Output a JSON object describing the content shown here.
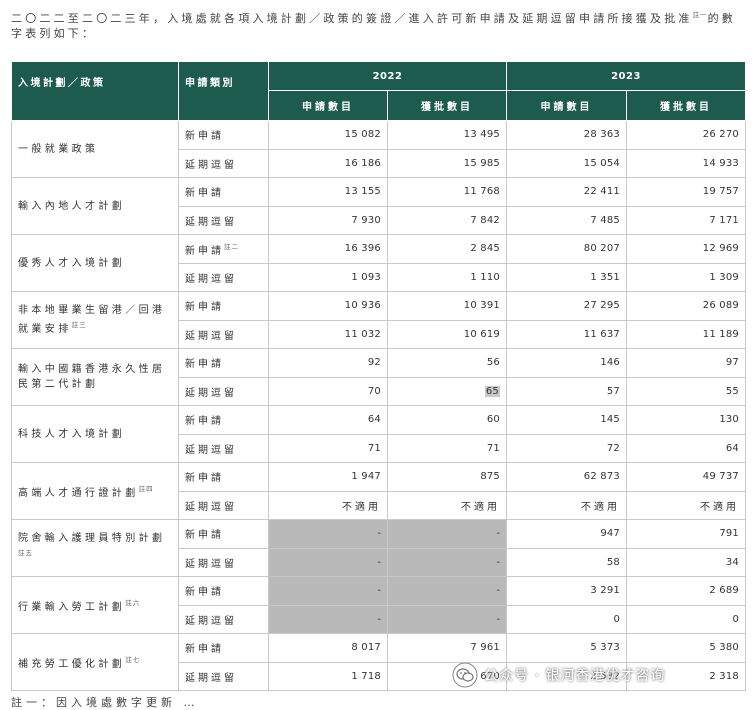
{
  "intro": {
    "text": "二〇二二至二〇二三年，入境處就各項入境計劃／政策的簽證／進入許可新申請及延期逗留申請所接獲及批准",
    "note": "註一",
    "text_end": "的數字表列如下："
  },
  "header": {
    "policy": "入境計劃／政策",
    "type": "申請類別",
    "year_2022": "2022",
    "year_2023": "2023",
    "applications": "申請數目",
    "approved": "獲批數目"
  },
  "groups": [
    {
      "policy": "一般就業政策",
      "note": "",
      "rows": [
        {
          "type": "新申請",
          "note": "",
          "a2022": "15 082",
          "b2022": "13 495",
          "a2023": "28 363",
          "b2023": "26 270"
        },
        {
          "type": "延期逗留",
          "note": "",
          "a2022": "16 186",
          "b2022": "15 985",
          "a2023": "15 054",
          "b2023": "14 933"
        }
      ]
    },
    {
      "policy": "輸入內地人才計劃",
      "note": "",
      "rows": [
        {
          "type": "新申請",
          "note": "",
          "a2022": "13 155",
          "b2022": "11 768",
          "a2023": "22 411",
          "b2023": "19 757"
        },
        {
          "type": "延期逗留",
          "note": "",
          "a2022": "7 930",
          "b2022": "7 842",
          "a2023": "7 485",
          "b2023": "7 171"
        }
      ]
    },
    {
      "policy": "優秀人才入境計劃",
      "note": "",
      "rows": [
        {
          "type": "新申請",
          "note": "註二",
          "a2022": "16 396",
          "b2022": "2 845",
          "a2023": "80 207",
          "b2023": "12 969"
        },
        {
          "type": "延期逗留",
          "note": "",
          "a2022": "1 093",
          "b2022": "1 110",
          "a2023": "1 351",
          "b2023": "1 309"
        }
      ]
    },
    {
      "policy": "非本地畢業生留港／回港就業安排",
      "note": "註三",
      "rows": [
        {
          "type": "新申請",
          "note": "",
          "a2022": "10 936",
          "b2022": "10 391",
          "a2023": "27 295",
          "b2023": "26 089"
        },
        {
          "type": "延期逗留",
          "note": "",
          "a2022": "11 032",
          "b2022": "10 619",
          "a2023": "11 637",
          "b2023": "11 189"
        }
      ]
    },
    {
      "policy": "輸入中國籍香港永久性居民第二代計劃",
      "note": "",
      "rows": [
        {
          "type": "新申請",
          "note": "",
          "a2022": "92",
          "b2022": "56",
          "a2023": "146",
          "b2023": "97"
        },
        {
          "type": "延期逗留",
          "note": "",
          "a2022": "70",
          "b2022": "65",
          "a2023": "57",
          "b2023": "55"
        }
      ]
    },
    {
      "policy": "科技人才入境計劃",
      "note": "",
      "rows": [
        {
          "type": "新申請",
          "note": "",
          "a2022": "64",
          "b2022": "60",
          "a2023": "145",
          "b2023": "130"
        },
        {
          "type": "延期逗留",
          "note": "",
          "a2022": "71",
          "b2022": "71",
          "a2023": "72",
          "b2023": "64"
        }
      ]
    },
    {
      "policy": "高端人才通行證計劃",
      "note": "註四",
      "rows": [
        {
          "type": "新申請",
          "note": "",
          "a2022": "1 947",
          "b2022": "875",
          "a2023": "62 873",
          "b2023": "49 737"
        },
        {
          "type": "延期逗留",
          "note": "",
          "a2022": "不適用",
          "b2022": "不適用",
          "a2023": "不適用",
          "b2023": "不適用"
        }
      ]
    },
    {
      "policy": "院舍輸入護理員特別計劃",
      "note": "註五",
      "rows": [
        {
          "type": "新申請",
          "note": "",
          "a2022": "-",
          "b2022": "-",
          "a2023": "947",
          "b2023": "791"
        },
        {
          "type": "延期逗留",
          "note": "",
          "a2022": "-",
          "b2022": "-",
          "a2023": "58",
          "b2023": "34"
        }
      ]
    },
    {
      "policy": "行業輸入勞工計劃",
      "note": "註六",
      "rows": [
        {
          "type": "新申請",
          "note": "",
          "a2022": "-",
          "b2022": "-",
          "a2023": "3 291",
          "b2023": "2 689"
        },
        {
          "type": "延期逗留",
          "note": "",
          "a2022": "-",
          "b2022": "-",
          "a2023": "0",
          "b2023": "0"
        }
      ]
    },
    {
      "policy": "補充勞工優化計劃",
      "note": "註七",
      "rows": [
        {
          "type": "新申請",
          "note": "",
          "a2022": "8 017",
          "b2022": "7 961",
          "a2023": "5 373",
          "b2023": "5 380"
        },
        {
          "type": "延期逗留",
          "note": "",
          "a2022": "1 718",
          "b2022": "1 670",
          "a2023": "2 582",
          "b2023": "2 318"
        }
      ]
    }
  ],
  "watermark": {
    "text": "公众号 · 银河香港优才咨询",
    "icon": "wechat-icon"
  },
  "footnote": {
    "text": "註一：因入境處數字更新 …",
    "color_header": "#1e5b4f",
    "color_na_fill": "#b9b9b9"
  }
}
